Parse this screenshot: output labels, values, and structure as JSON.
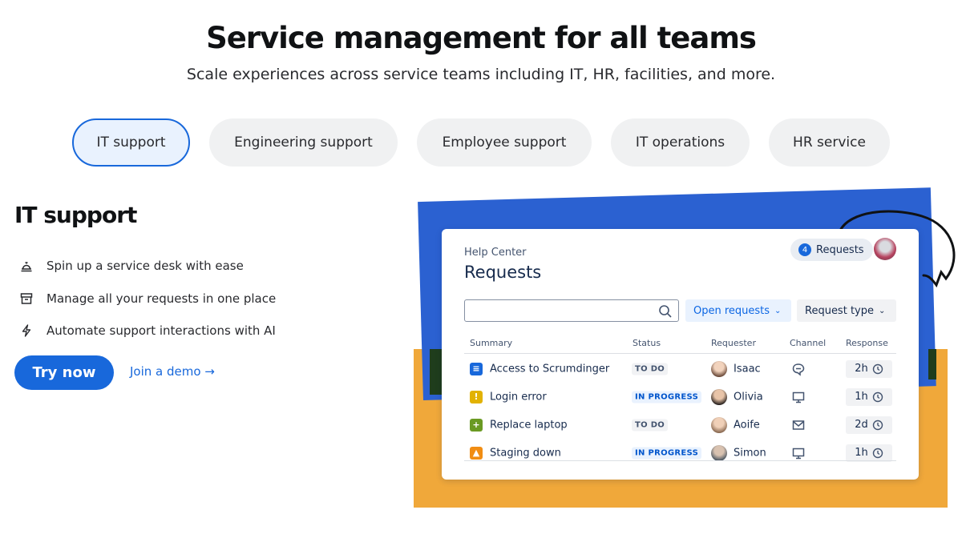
{
  "header": {
    "title": "Service management for all teams",
    "subtitle": "Scale experiences across service teams including IT, HR, facilities, and more."
  },
  "tabs": [
    {
      "label": "IT support",
      "active": true
    },
    {
      "label": "Engineering support",
      "active": false
    },
    {
      "label": "Employee support",
      "active": false
    },
    {
      "label": "IT operations",
      "active": false
    },
    {
      "label": "HR service",
      "active": false
    }
  ],
  "section": {
    "title": "IT support",
    "features": [
      {
        "icon": "bell-icon",
        "text": "Spin up a service desk with ease"
      },
      {
        "icon": "archive-icon",
        "text": "Manage all your requests in one place"
      },
      {
        "icon": "lightning-icon",
        "text": "Automate support interactions with AI"
      }
    ],
    "cta_label": "Try now",
    "demo_label": "Join a demo →"
  },
  "card": {
    "help_center": "Help Center",
    "title": "Requests",
    "requests_count": "4",
    "requests_label": "Requests",
    "search_placeholder": "",
    "filter_open": "Open requests",
    "filter_type": "Request type",
    "columns": {
      "summary": "Summary",
      "status": "Status",
      "requester": "Requester",
      "channel": "Channel",
      "response": "Response"
    },
    "rows": [
      {
        "summary": "Access to Scrumdinger",
        "status": "TO DO",
        "requester": "Isaac",
        "channel": "chat-icon",
        "response": "2h",
        "icon_color": "#1868db",
        "icon_glyph": "≡"
      },
      {
        "summary": "Login error",
        "status": "IN PROGRESS",
        "requester": "Olivia",
        "channel": "monitor-icon",
        "response": "1h",
        "icon_color": "#e2b203",
        "icon_glyph": "!"
      },
      {
        "summary": "Replace laptop",
        "status": "TO DO",
        "requester": "Aoife",
        "channel": "mail-icon",
        "response": "2d",
        "icon_color": "#6a9a23",
        "icon_glyph": "+"
      },
      {
        "summary": "Staging down",
        "status": "IN PROGRESS",
        "requester": "Simon",
        "channel": "monitor-icon",
        "response": "1h",
        "icon_color": "#f18d13",
        "icon_glyph": "▲"
      }
    ]
  },
  "colors": {
    "brand_blue": "#1868db",
    "art_blue": "#2b61d1",
    "art_yellow": "#f0a83a"
  }
}
